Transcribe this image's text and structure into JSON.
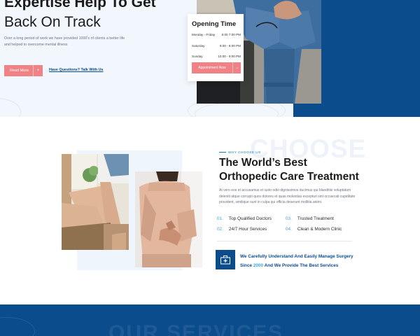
{
  "hero": {
    "title_line1": "Expertise Help To Get",
    "title_line2": "Back On Track",
    "description": "Over a long period of work we have provided 1000's of clients a better life and helped to overcome mental illness",
    "read_more": "Read More",
    "arrow": "+",
    "talk_link": "Have Questions? Talk With Us"
  },
  "opening": {
    "title": "Opening Time",
    "rows": [
      {
        "day": "Monday - Friday",
        "time": "6:00 7:00 PM"
      },
      {
        "day": "Saturday",
        "time": "9:00 - 8:00 PM"
      },
      {
        "day": "Sunday",
        "time": "10:00 - 9:00 PM"
      }
    ],
    "appointment": "Appointment Now",
    "arrow": "→"
  },
  "why": {
    "tag": "WHY CHOOSE US",
    "bg_word": "CHOOSE",
    "title_line1": "The World’s Best",
    "title_bold": "Orthopedic",
    "title_rest": " Care Treatment",
    "description": "At vero eos et accusamus et iusto odio dignissimos ducimus qui blanditiis voluptatum deleniti atque corrupti quos dolores et quas molestias excepturi sint occaecati cupiditate provident, similique sunt in culpa qui officia deserunt mollitia animi.",
    "features": [
      {
        "num": "01.",
        "label": "Top Qualified Doctors"
      },
      {
        "num": "02.",
        "label": "24/7 Hour Services"
      },
      {
        "num": "03.",
        "label": "Trusted Treatment"
      },
      {
        "num": "04.",
        "label": "Clean & Modern Clinic"
      }
    ],
    "surgery_line1": "We Carefully Understand And Easily Manage Surgery",
    "surgery_prefix": "Since ",
    "surgery_year": "2000",
    "surgery_suffix": " And We Provide The Best Services"
  },
  "services": {
    "bg_word": "OUR SERVICES"
  },
  "colors": {
    "primary_blue": "#0b4c8c",
    "accent_pink": "#f08285",
    "light_bg": "#f1f7fd",
    "link_blue": "#37a6e0"
  }
}
